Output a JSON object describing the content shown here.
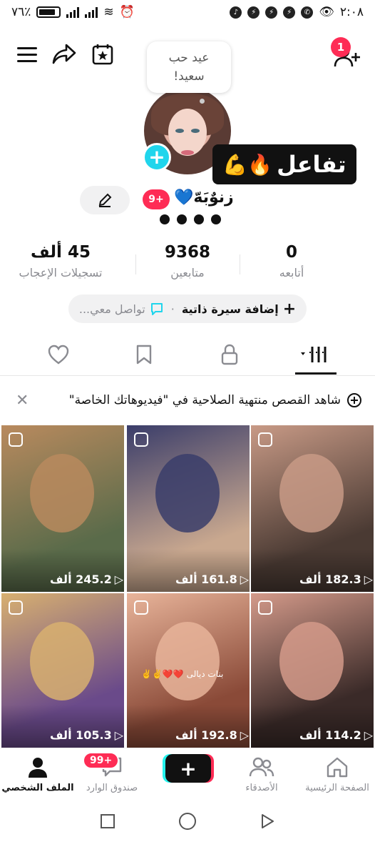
{
  "status_bar": {
    "battery": "٧٦٪",
    "time": "٢:٠٨"
  },
  "header": {
    "notification_count": "1",
    "note_line1": "عيد حب",
    "note_line2": "سعيد!"
  },
  "profile": {
    "sticker_text": "تفاعل",
    "sticker_emojis": "🔥💪",
    "display_name": "زنوٌبَهّ💙",
    "level_badge": "9+",
    "username_dots": "● ● ● ●"
  },
  "stats": [
    {
      "value": "0",
      "label": "أتابعه"
    },
    {
      "value": "9368",
      "label": "متابعين"
    },
    {
      "value": "45 ألف",
      "label": "تسجيلات الإعجاب"
    }
  ],
  "bio": {
    "add_bio": "إضافة سيرة ذاتية",
    "contact": "تواصل معي..."
  },
  "banner": {
    "text": "شاهد القصص منتهية الصلاحية في \"فيديوهاتك الخاصة\""
  },
  "videos": [
    {
      "views": "182.3 ألف",
      "colors": [
        "#4a3a33",
        "#c89a86"
      ]
    },
    {
      "views": "161.8 ألف",
      "colors": [
        "#c9a88f",
        "#3a3d6a"
      ]
    },
    {
      "views": "245.2 ألف",
      "colors": [
        "#5a6b4a",
        "#b98a5e"
      ]
    },
    {
      "views": "114.2 ألف",
      "colors": [
        "#3a2a28",
        "#d49a8a"
      ]
    },
    {
      "views": "192.8 ألف",
      "colors": [
        "#8a4a38",
        "#e8b49a"
      ],
      "caption": "بنات ديالى ❤️❤️✌️✌️"
    },
    {
      "views": "105.3 ألف",
      "colors": [
        "#6a4a8a",
        "#d8b070"
      ]
    }
  ],
  "bottom_nav": {
    "home": "الصفحة الرئيسية",
    "friends": "الأصدقاء",
    "create": "+",
    "inbox": "صندوق الوارد",
    "inbox_badge": "99+",
    "profile": "الملف الشخصي"
  },
  "colors": {
    "accent": "#fe2c55",
    "cyan": "#25f4ee",
    "text": "#161823",
    "muted": "#8a8b91"
  }
}
